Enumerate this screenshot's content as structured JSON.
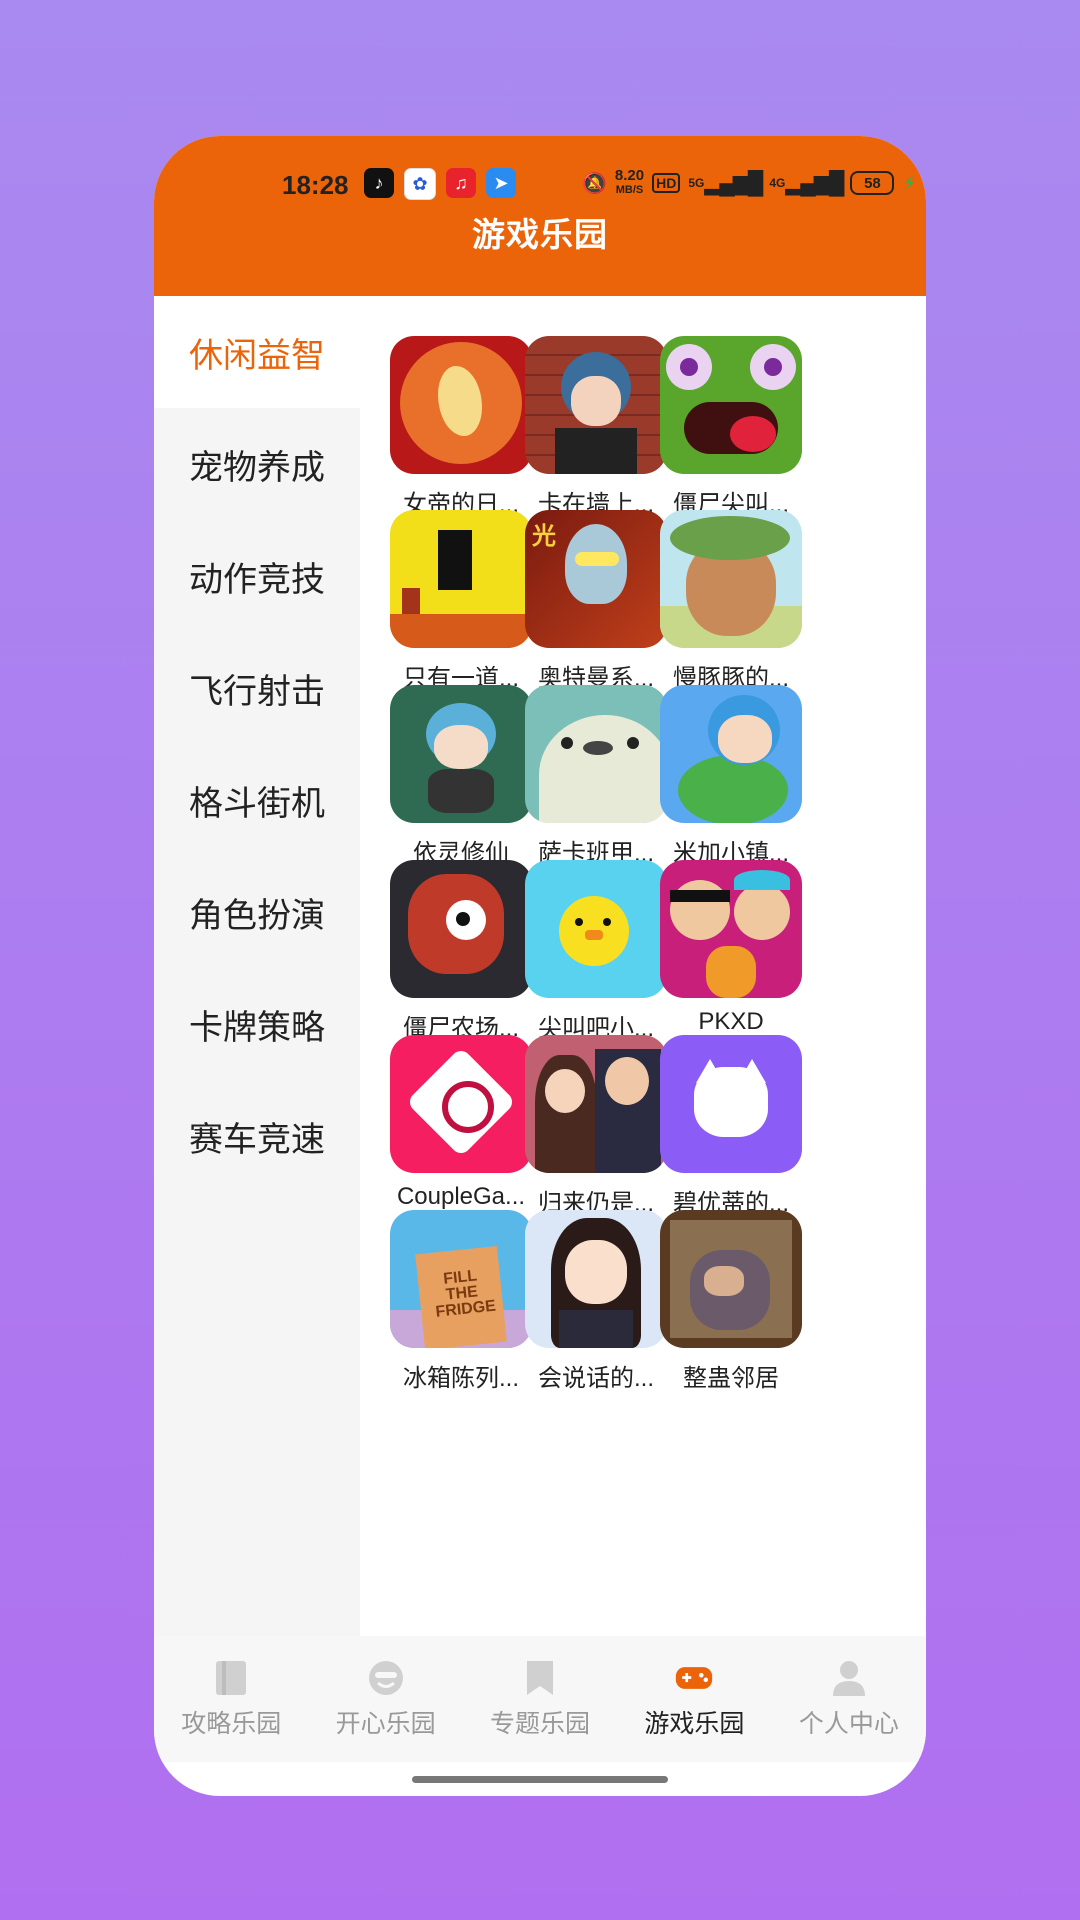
{
  "status_bar": {
    "time": "18:28",
    "net_speed_value": "8.20",
    "net_speed_unit": "MB/S",
    "hd_badge": "HD",
    "signal_5g": "5G",
    "signal_4g": "4G",
    "battery": "58"
  },
  "header": {
    "title": "游戏乐园"
  },
  "sidebar": {
    "items": [
      {
        "label": "休闲益智",
        "active": true
      },
      {
        "label": "宠物养成",
        "active": false
      },
      {
        "label": "动作竞技",
        "active": false
      },
      {
        "label": "飞行射击",
        "active": false
      },
      {
        "label": "格斗街机",
        "active": false
      },
      {
        "label": "角色扮演",
        "active": false
      },
      {
        "label": "卡牌策略",
        "active": false
      },
      {
        "label": "赛车竞速",
        "active": false
      }
    ]
  },
  "games": [
    {
      "label": "女帝的日..."
    },
    {
      "label": "卡在墙上..."
    },
    {
      "label": "僵尸尖叫..."
    },
    {
      "label": "只有一道..."
    },
    {
      "label": "奥特曼系..."
    },
    {
      "label": "慢豚豚的..."
    },
    {
      "label": "依灵修仙"
    },
    {
      "label": "萨卡班甲..."
    },
    {
      "label": "米加小镇..."
    },
    {
      "label": "僵尸农场..."
    },
    {
      "label": "尖叫吧小..."
    },
    {
      "label": "PKXD"
    },
    {
      "label": "CoupleGa..."
    },
    {
      "label": "归来仍是..."
    },
    {
      "label": "碧优蒂的..."
    },
    {
      "label": "冰箱陈列..."
    },
    {
      "label": "会说话的..."
    },
    {
      "label": "整蛊邻居"
    }
  ],
  "tabbar": {
    "items": [
      {
        "label": "攻略乐园",
        "icon": "book-icon"
      },
      {
        "label": "开心乐园",
        "icon": "smile-icon"
      },
      {
        "label": "专题乐园",
        "icon": "bookmark-icon"
      },
      {
        "label": "游戏乐园",
        "icon": "gamepad-icon",
        "active": true
      },
      {
        "label": "个人中心",
        "icon": "person-icon"
      }
    ]
  },
  "colors": {
    "accent": "#ec6409",
    "background": "#b07cf0"
  }
}
